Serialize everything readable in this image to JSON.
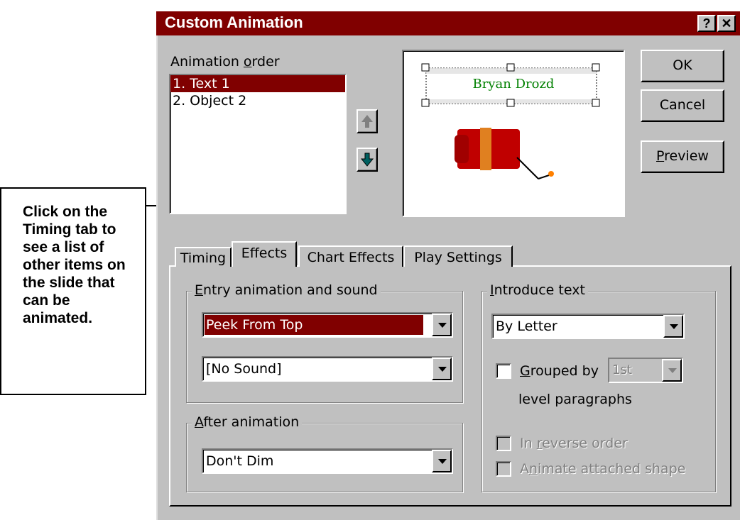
{
  "dialog": {
    "title": "Custom Animation",
    "help_button": "?",
    "close_button": "✕"
  },
  "animation_order": {
    "label_pre": "Animation ",
    "label_accel": "o",
    "label_post": "rder",
    "items": [
      "1. Text 1",
      "2. Object 2"
    ],
    "selected_index": 0
  },
  "preview": {
    "text": "Bryan Drozd",
    "text_color": "#008000",
    "image": "dynamite-icon"
  },
  "buttons": {
    "ok": "OK",
    "cancel": "Cancel",
    "preview_accel": "P",
    "preview_rest": "review"
  },
  "tabs": [
    {
      "label": "Timing",
      "active": false
    },
    {
      "label": "Effects",
      "active": true
    },
    {
      "label": "Chart Effects",
      "active": false
    },
    {
      "label": "Play Settings",
      "active": false
    }
  ],
  "entry_group": {
    "label_accel": "E",
    "label_rest": "ntry animation and sound",
    "effect_value": "Peek From Top",
    "sound_value": "[No Sound]"
  },
  "after_group": {
    "label_accel": "A",
    "label_rest": "fter animation",
    "value": "Don't Dim"
  },
  "introduce_group": {
    "label_accel": "I",
    "label_rest": "ntroduce text",
    "value": "By Letter",
    "grouped_by_accel": "G",
    "grouped_by_rest": "rouped by",
    "grouped_level_value": "1st",
    "level_paragraphs": "level paragraphs",
    "reverse_pre": "In ",
    "reverse_accel": "r",
    "reverse_rest": "everse order",
    "attached_pre": "A",
    "attached_accel": "n",
    "attached_rest": "imate attached shape"
  },
  "callout": {
    "text": "Click on the Timing tab to see a list of other items on the slide that can be animated."
  },
  "colors": {
    "titlebar": "#800000",
    "face": "#c0c0c0",
    "selection": "#800000"
  }
}
